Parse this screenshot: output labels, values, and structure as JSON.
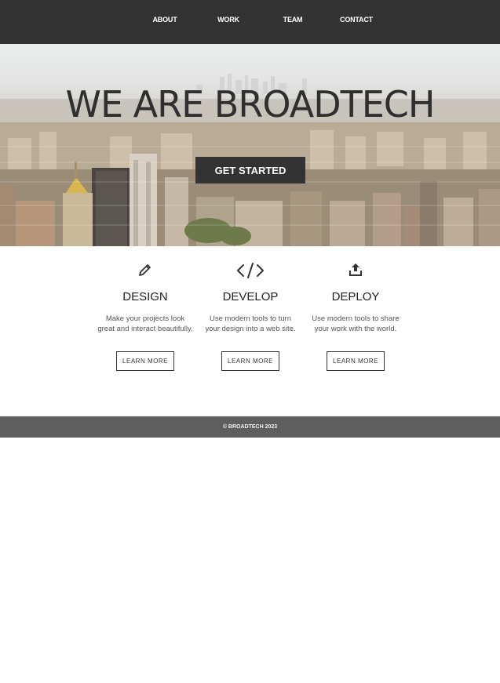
{
  "nav": {
    "items": [
      {
        "label": "ABOUT"
      },
      {
        "label": "WORK"
      },
      {
        "label": "TEAM"
      },
      {
        "label": "CONTACT"
      }
    ]
  },
  "hero": {
    "title": "WE ARE BROADTECH",
    "cta_label": "GET STARTED"
  },
  "features": [
    {
      "icon": "pencil-icon",
      "title": "DESIGN",
      "description": "Make your projects look great and interact beautifully.",
      "button": "LEARN MORE"
    },
    {
      "icon": "code-icon",
      "title": "DEVELOP",
      "description": "Use modern tools to turn your design into a web site.",
      "button": "LEARN MORE"
    },
    {
      "icon": "upload-icon",
      "title": "DEPLOY",
      "description": "Use modern tools to share your work with the world.",
      "button": "LEARN MORE"
    }
  ],
  "footer": {
    "text": "© BROADTECH 2023"
  },
  "colors": {
    "navbar": "#333333",
    "footer": "#5e5e5e",
    "button": "#333333"
  }
}
